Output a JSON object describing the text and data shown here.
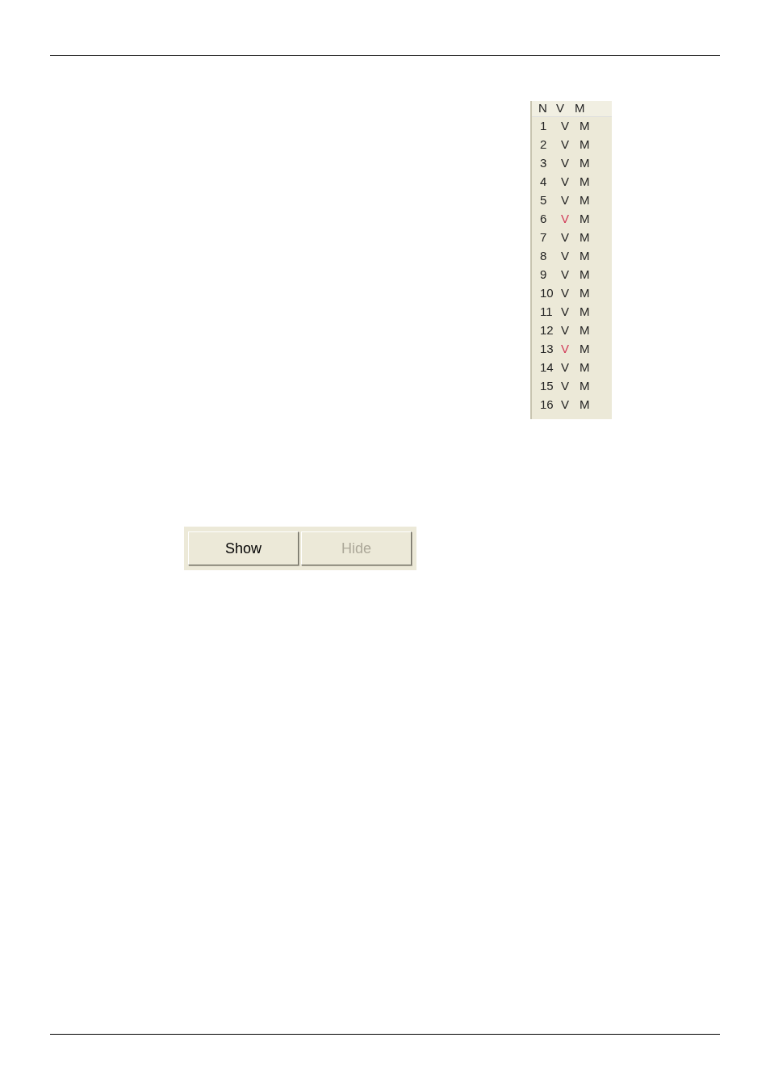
{
  "list": {
    "columns": [
      "N",
      "V",
      "M"
    ],
    "rows": [
      {
        "n": "1",
        "v": "V",
        "m": "M",
        "highlighted": false
      },
      {
        "n": "2",
        "v": "V",
        "m": "M",
        "highlighted": false
      },
      {
        "n": "3",
        "v": "V",
        "m": "M",
        "highlighted": false
      },
      {
        "n": "4",
        "v": "V",
        "m": "M",
        "highlighted": false
      },
      {
        "n": "5",
        "v": "V",
        "m": "M",
        "highlighted": false
      },
      {
        "n": "6",
        "v": "V",
        "m": "M",
        "highlighted": true
      },
      {
        "n": "7",
        "v": "V",
        "m": "M",
        "highlighted": false
      },
      {
        "n": "8",
        "v": "V",
        "m": "M",
        "highlighted": false
      },
      {
        "n": "9",
        "v": "V",
        "m": "M",
        "highlighted": false
      },
      {
        "n": "10",
        "v": "V",
        "m": "M",
        "highlighted": false
      },
      {
        "n": "11",
        "v": "V",
        "m": "M",
        "highlighted": false
      },
      {
        "n": "12",
        "v": "V",
        "m": "M",
        "highlighted": false
      },
      {
        "n": "13",
        "v": "V",
        "m": "M",
        "highlighted": true
      },
      {
        "n": "14",
        "v": "V",
        "m": "M",
        "highlighted": false
      },
      {
        "n": "15",
        "v": "V",
        "m": "M",
        "highlighted": false
      },
      {
        "n": "16",
        "v": "V",
        "m": "M",
        "highlighted": false
      }
    ]
  },
  "buttons": [
    {
      "label": "Show",
      "disabled": false
    },
    {
      "label": "Hide",
      "disabled": true
    }
  ]
}
